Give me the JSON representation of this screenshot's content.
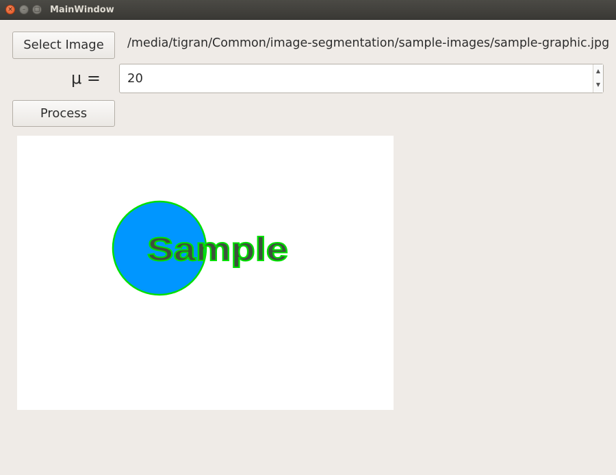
{
  "window": {
    "title": "MainWindow"
  },
  "titlebar": {
    "close_glyph": "×",
    "minimize_glyph": "–",
    "maximize_glyph": "□"
  },
  "controls": {
    "select_label": "Select Image",
    "file_path": "/media/tigran/Common/image-segmentation/sample-images/sample-graphic.jpg",
    "mu_label": "μ =",
    "mu_value": "20",
    "spin_up_glyph": "▲",
    "spin_down_glyph": "▼",
    "process_label": "Process"
  },
  "image": {
    "text": "Sample",
    "circle_color": "#0096ff",
    "contour_color": "#00e000",
    "text_color": "#3f4f3f"
  },
  "icons": [
    "close-icon",
    "minimize-icon",
    "maximize-icon",
    "spin-up-icon",
    "spin-down-icon"
  ]
}
